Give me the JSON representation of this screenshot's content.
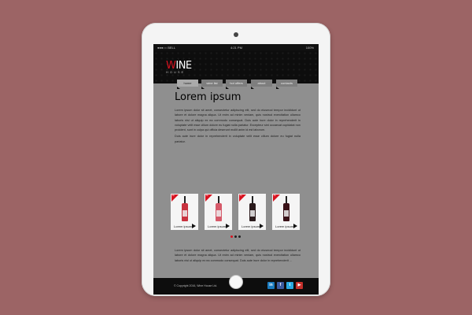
{
  "status_bar": {
    "carrier": "●●●○○ BELL",
    "time": "4:21 PM",
    "battery": "100%"
  },
  "brand": {
    "logo_initial": "W",
    "logo_rest": "INE",
    "logo_sub": "HOUSE"
  },
  "nav": {
    "tabs": [
      {
        "label": "home",
        "active": true
      },
      {
        "label": "wine list",
        "active": false
      },
      {
        "label": "hot offers",
        "active": false
      },
      {
        "label": "about",
        "active": false
      },
      {
        "label": "contacts",
        "active": false
      }
    ]
  },
  "main": {
    "title": "Lorem ipsum",
    "paragraph1": "Lorem ipsum dolor sit amet, consectetur adipiscing elit, sed do eiusmod tempor incididunt ut labore et dolore magna aliqua. Ut enim ad minim veniam, quis nostrud exercitation ullamco laboris nisi ut aliquip ex ea commodo consequat. Duis aute irure dolor in reprehenderit in voluptate velit esse cillum dolore eu fugiat nulla pariatur. Excepteur sint occaecat cupidatat non proident, sunt in culpa qui officia deserunt mollit anim id est laborum.",
    "paragraph2": "Duis aute irure dolor in reprehenderit in voluptate velit esse cillum dolore eu fugiat nulla pariatur.",
    "paragraph3": "Lorem ipsum dolor sit amet, consectetur adipiscing elit, sed do eiusmod tempor incididunt ut labore et dolore magna aliqua. Ut enim ad minim veniam, quis nostrud exercitation ullamco laboris nisi ut aliquip ex ea commodo consequat. Duis aute irure dolor in reprehenderit ..."
  },
  "products": [
    {
      "label": "Lorem ipsum",
      "badge": "-%",
      "color": "#c8323f"
    },
    {
      "label": "Lorem ipsum",
      "badge": "-%",
      "color": "#d65a6a"
    },
    {
      "label": "Lorem ipsum",
      "badge": "-%",
      "color": "#2a1a1c"
    },
    {
      "label": "Lorem ipsum",
      "badge": "-%",
      "color": "#3a1218"
    }
  ],
  "carousel": {
    "active_index": 0,
    "count": 3
  },
  "footer": {
    "copyright": "© Copyright 2016, Wine House Ltd.",
    "social": [
      {
        "name": "linkedin-icon",
        "glyph": "in"
      },
      {
        "name": "facebook-icon",
        "glyph": "f"
      },
      {
        "name": "twitter-icon",
        "glyph": "t"
      },
      {
        "name": "youtube-icon",
        "glyph": "▶"
      }
    ]
  },
  "colors": {
    "background": "#9c6465",
    "accent": "#d8121f",
    "header": "#0d0d0d",
    "content": "#8f8f8f"
  }
}
